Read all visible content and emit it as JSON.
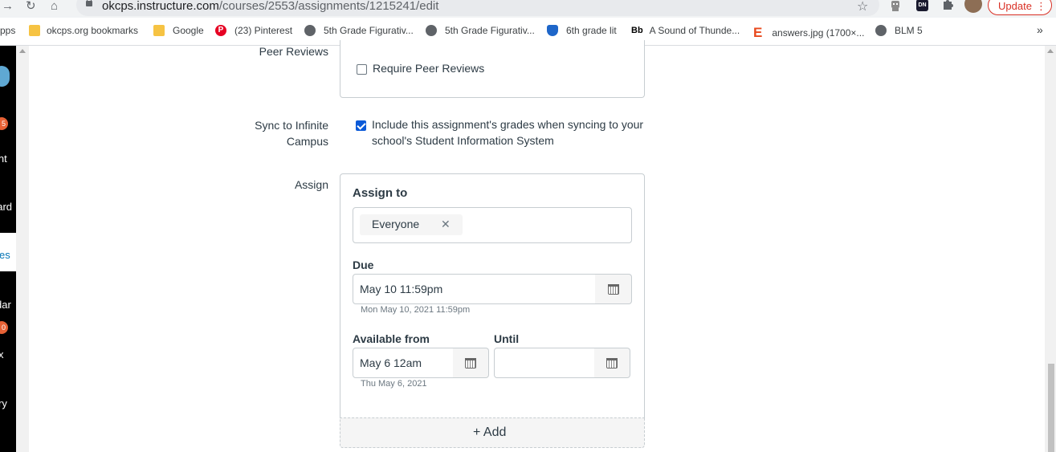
{
  "browser": {
    "url_host": "okcps.instructure.com",
    "url_path": "/courses/2553/assignments/1215241/edit",
    "update_label": "Update",
    "ext_dn_label": "DN"
  },
  "bookmarks": [
    {
      "label": "pps",
      "icon": "apps-grid-icon"
    },
    {
      "label": "okcps.org bookmarks",
      "icon": "folder-icon"
    },
    {
      "label": "Google",
      "icon": "folder-icon"
    },
    {
      "label": "(23) Pinterest",
      "icon": "pinterest-icon"
    },
    {
      "label": "5th Grade Figurativ...",
      "icon": "globe-icon"
    },
    {
      "label": "5th Grade Figurativ...",
      "icon": "globe-icon"
    },
    {
      "label": "6th grade lit",
      "icon": "shield-icon"
    },
    {
      "label": "A Sound of Thunde...",
      "icon": "bb-icon",
      "prefix": "Bb"
    },
    {
      "label": "answers.jpg (1700×...",
      "icon": "e-icon",
      "prefix": "E"
    },
    {
      "label": "BLM 5",
      "icon": "globe-icon"
    }
  ],
  "bookmarks_overflow": "»",
  "left_nav": {
    "items": [
      {
        "label": "nt",
        "badge": "5"
      },
      {
        "label": "oard",
        "badge": ""
      },
      {
        "label": "es",
        "badge": ""
      },
      {
        "label": "dar",
        "badge": ""
      },
      {
        "label": "x",
        "badge": "0"
      },
      {
        "label": "ry",
        "badge": ""
      }
    ]
  },
  "form": {
    "peer_reviews": {
      "label": "Peer Reviews",
      "option": "Require Peer Reviews",
      "checked": false
    },
    "sync": {
      "label_line1": "Sync to Infinite",
      "label_line2": "Campus",
      "option_line1": "Include this assignment's grades when syncing to your",
      "option_line2": "school's Student Information System",
      "checked": true
    },
    "assign": {
      "label": "Assign",
      "assign_to_heading": "Assign to",
      "assignee": "Everyone",
      "remove_glyph": "✕",
      "due_label": "Due",
      "due_value": "May 10 11:59pm",
      "due_hint": "Mon May 10, 2021 11:59pm",
      "available_from_label": "Available from",
      "available_from_value": "May 6 12am",
      "available_from_hint": "Thu May 6, 2021",
      "until_label": "Until",
      "until_value": "",
      "add_label": "+ Add"
    }
  }
}
